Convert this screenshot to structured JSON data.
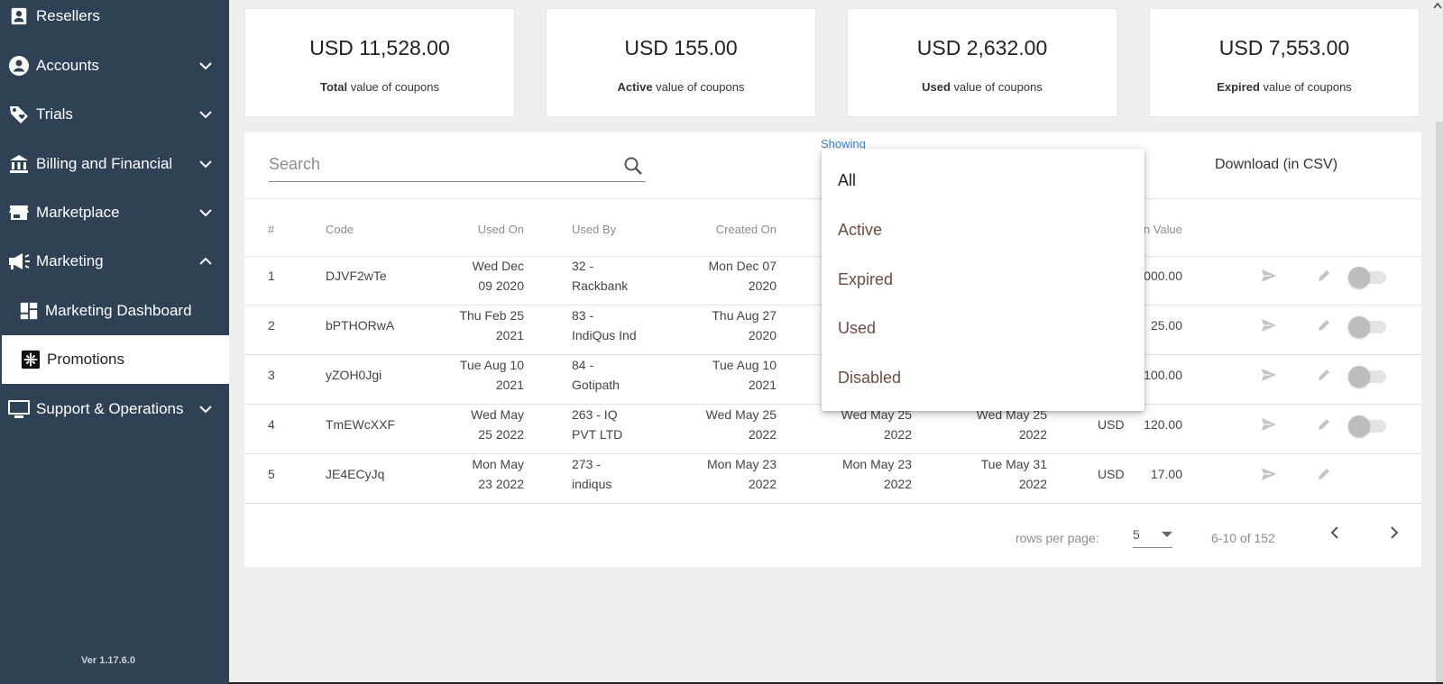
{
  "sidebar": {
    "items": [
      {
        "label": "Resellers",
        "icon": "person-card-icon"
      },
      {
        "label": "Accounts",
        "icon": "account-circle-icon"
      },
      {
        "label": "Trials",
        "icon": "tag-icon"
      },
      {
        "label": "Billing and Financial",
        "icon": "bank-icon"
      },
      {
        "label": "Marketplace",
        "icon": "store-icon"
      },
      {
        "label": "Marketing",
        "icon": "megaphone-icon"
      },
      {
        "label": "Marketing Dashboard",
        "icon": "dashboard-icon"
      },
      {
        "label": "Promotions",
        "icon": "promotions-icon"
      },
      {
        "label": "Support & Operations",
        "icon": "monitor-icon"
      }
    ],
    "version": "Ver 1.17.6.0"
  },
  "cards": [
    {
      "amount": "USD 11,528.00",
      "bold": "Total",
      "rest": " value of coupons"
    },
    {
      "amount": "USD 155.00",
      "bold": "Active",
      "rest": " value of coupons"
    },
    {
      "amount": "USD 2,632.00",
      "bold": "Used",
      "rest": " value of coupons"
    },
    {
      "amount": "USD 7,553.00",
      "bold": "Expired",
      "rest": " value of coupons"
    }
  ],
  "toolbar": {
    "search_placeholder": "Search",
    "showing_label": "Showing",
    "download_label": "Download (in CSV)"
  },
  "table": {
    "headers": [
      "#",
      "Code",
      "Used On",
      "Used By",
      "Created On",
      "on Value"
    ],
    "rows": [
      {
        "num": "1",
        "code": "DJVF2wTe",
        "used_on_1": "Wed Dec",
        "used_on_2": "09 2020",
        "used_by_1": "32 -",
        "used_by_2": "Rackbank",
        "created_1": "Mon Dec 07",
        "created_2": "2020",
        "value": ",000.00"
      },
      {
        "num": "2",
        "code": "bPTHORwA",
        "used_on_1": "Thu Feb 25",
        "used_on_2": "2021",
        "used_by_1": "83 -",
        "used_by_2": "IndiQus Ind",
        "created_1": "Thu Aug 27",
        "created_2": "2020",
        "value": "25.00"
      },
      {
        "num": "3",
        "code": "yZOH0Jgi",
        "used_on_1": "Tue Aug 10",
        "used_on_2": "2021",
        "used_by_1": "84 -",
        "used_by_2": "Gotipath",
        "created_1": "Tue Aug 10",
        "created_2": "2021",
        "value": "100.00"
      },
      {
        "num": "4",
        "code": "TmEWcXXF",
        "used_on_1": "Wed May",
        "used_on_2": "25 2022",
        "used_by_1": "263 - IQ",
        "used_by_2": "PVT LTD",
        "created_1": "Wed May 25",
        "created_2": "2022",
        "start_1": "Wed May 25",
        "start_2": "2022",
        "end_1": "Wed May 25",
        "end_2": "2022",
        "currency": "USD",
        "value": "120.00"
      },
      {
        "num": "5",
        "code": "JE4ECyJq",
        "used_on_1": "Mon May",
        "used_on_2": "23 2022",
        "used_by_1": "273 -",
        "used_by_2": "indiqus",
        "created_1": "Mon May 23",
        "created_2": "2022",
        "start_1": "Mon May 23",
        "start_2": "2022",
        "end_1": "Tue May 31",
        "end_2": "2022",
        "currency": "USD",
        "value": "17.00"
      }
    ]
  },
  "pager": {
    "rows_label": "rows per page:",
    "rows_value": "5",
    "range": "6-10 of 152"
  },
  "dropdown": {
    "options": [
      "All",
      "Active",
      "Expired",
      "Used",
      "Disabled"
    ],
    "selected": "All"
  },
  "colors": {
    "sidebar_bg": "#2f4255",
    "link_blue": "#3b7fd1",
    "option_brown": "#6d4c41"
  }
}
